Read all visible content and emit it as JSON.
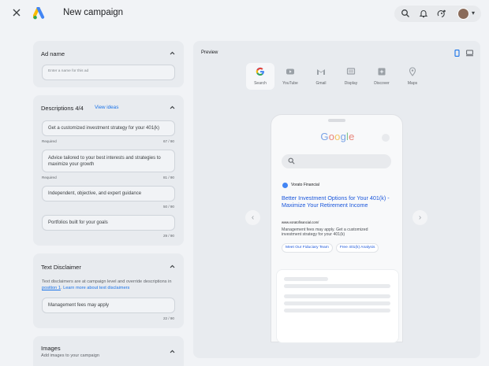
{
  "header": {
    "title": "New campaign",
    "close_icon": "close-icon",
    "logo": "google-ads-logo",
    "actions": [
      "search-icon",
      "bell-icon",
      "help-icon"
    ],
    "colors": {
      "ads_blue": "#4285f4",
      "ads_yellow": "#fbbc04",
      "ads_green": "#34a853"
    }
  },
  "ad_name": {
    "title": "Ad name",
    "placeholder": "Enter a name for this ad"
  },
  "descriptions": {
    "title": "Descriptions 4/4",
    "view_ideas": "View ideas",
    "items": [
      {
        "text": "Get a customized investment strategy for your 401(k)",
        "required": "Required",
        "count": "67 / 90"
      },
      {
        "text": "Advice tailored to your best interests and strategies to maximize your growth",
        "required": "Required",
        "count": "81 / 90"
      },
      {
        "text": "Independent, objective, and expert guidance",
        "required": "",
        "count": "50 / 90"
      },
      {
        "text": "Portfolios built for your goals",
        "required": "",
        "count": "29 / 90"
      }
    ]
  },
  "text_disclaimer": {
    "title": "Text Disclaimer",
    "description_prefix": "Text disclaimers are at campaign level and override descriptions in ",
    "position_link": "position 1",
    "description_suffix": ".",
    "learn_more": "Learn more about text disclaimers",
    "value": "Management fees may apply",
    "count": "22 / 90"
  },
  "images": {
    "title": "Images",
    "subtitle": "Add images to your campaign"
  },
  "preview": {
    "label": "Preview",
    "device_icons": [
      "phone-icon",
      "desktop-icon"
    ],
    "channels": [
      {
        "label": "Search",
        "icon": "google-g-icon",
        "active": true
      },
      {
        "label": "YouTube",
        "icon": "youtube-icon",
        "active": false
      },
      {
        "label": "Gmail",
        "icon": "gmail-icon",
        "active": false
      },
      {
        "label": "Display",
        "icon": "display-icon",
        "active": false
      },
      {
        "label": "Discover",
        "icon": "discover-icon",
        "active": false
      },
      {
        "label": "Maps",
        "icon": "maps-pin-icon",
        "active": false
      }
    ],
    "phone": {
      "brand": "Google",
      "advertiser": "Vorato Financial",
      "headline": "Better Investment Options for Your 401(k) - Maximize Your Retirement Income",
      "url": "www.voratofinancial.com/",
      "description": "Management fees may apply. Get a customized investment strategy for your 401(k)",
      "sitelinks": [
        "Meet Our Fiduciary Team",
        "Free 401(k) Analysis"
      ]
    }
  }
}
